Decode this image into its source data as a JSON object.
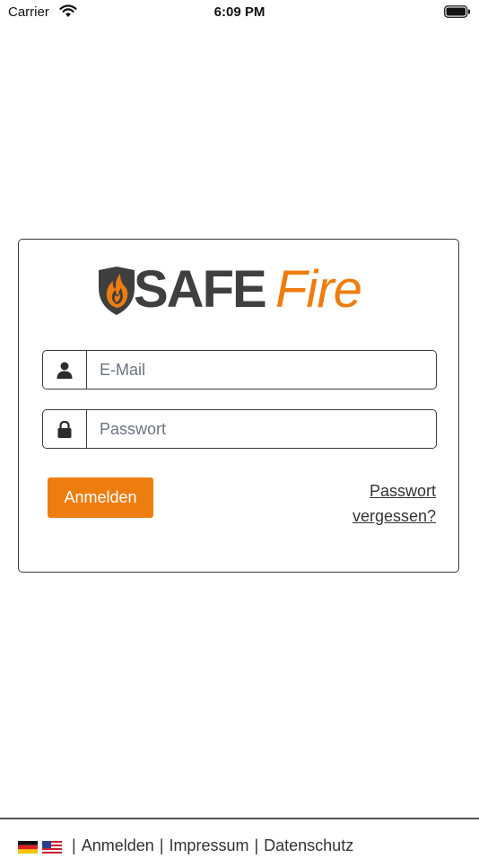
{
  "status_bar": {
    "carrier": "Carrier",
    "time": "6:09 PM"
  },
  "logo": {
    "part1": "SAFE",
    "part2": "Fire",
    "accent_color": "#ee7d10",
    "dark_color": "#3f3f3f"
  },
  "form": {
    "email_placeholder": "E-Mail",
    "email_icon": "user-icon",
    "password_placeholder": "Passwort",
    "password_icon": "lock-icon",
    "submit_label": "Anmelden",
    "forgot_line1": "Passwort",
    "forgot_line2": "vergessen?"
  },
  "footer": {
    "flags": [
      "german-flag-icon",
      "us-flag-icon"
    ],
    "links": [
      "Anmelden",
      "Impressum",
      "Datenschutz"
    ],
    "separator": "|"
  }
}
